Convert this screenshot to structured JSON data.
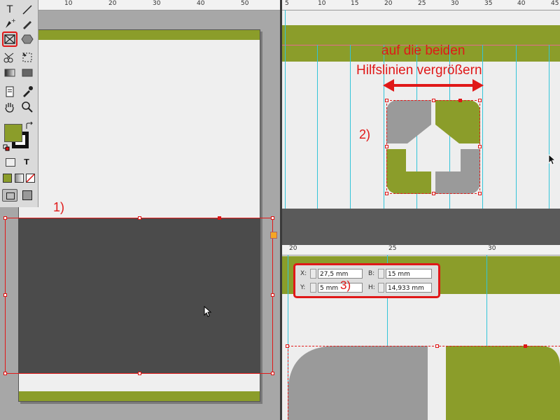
{
  "rulers": {
    "left_ticks": [
      "10",
      "20",
      "30",
      "40",
      "50"
    ],
    "top_right_ticks": [
      "5",
      "10",
      "15",
      "20",
      "25",
      "30",
      "35",
      "40",
      "45"
    ],
    "bottom_right_ticks": [
      "20",
      "25",
      "30"
    ]
  },
  "tools": {
    "type_glyph": "T",
    "text_glyph": "T"
  },
  "annotations": {
    "step1": "1)",
    "step2": "2)",
    "step3": "3)",
    "instruction_line1": "auf die beiden",
    "instruction_line2": "Hilfslinien vergrößern"
  },
  "control_panel": {
    "x_label": "X:",
    "x_value": "27,5 mm",
    "y_label": "Y:",
    "y_value": "5 mm",
    "b_label": "B:",
    "b_value": "15 mm",
    "h_label": "H:",
    "h_value": "14,933 mm"
  },
  "colors": {
    "green": "#8b9d2a",
    "dark_frame": "#4b4b4b",
    "gray_shape": "#9a9a9a",
    "guide": "#33c4d9",
    "annotation_red": "#e01818"
  }
}
